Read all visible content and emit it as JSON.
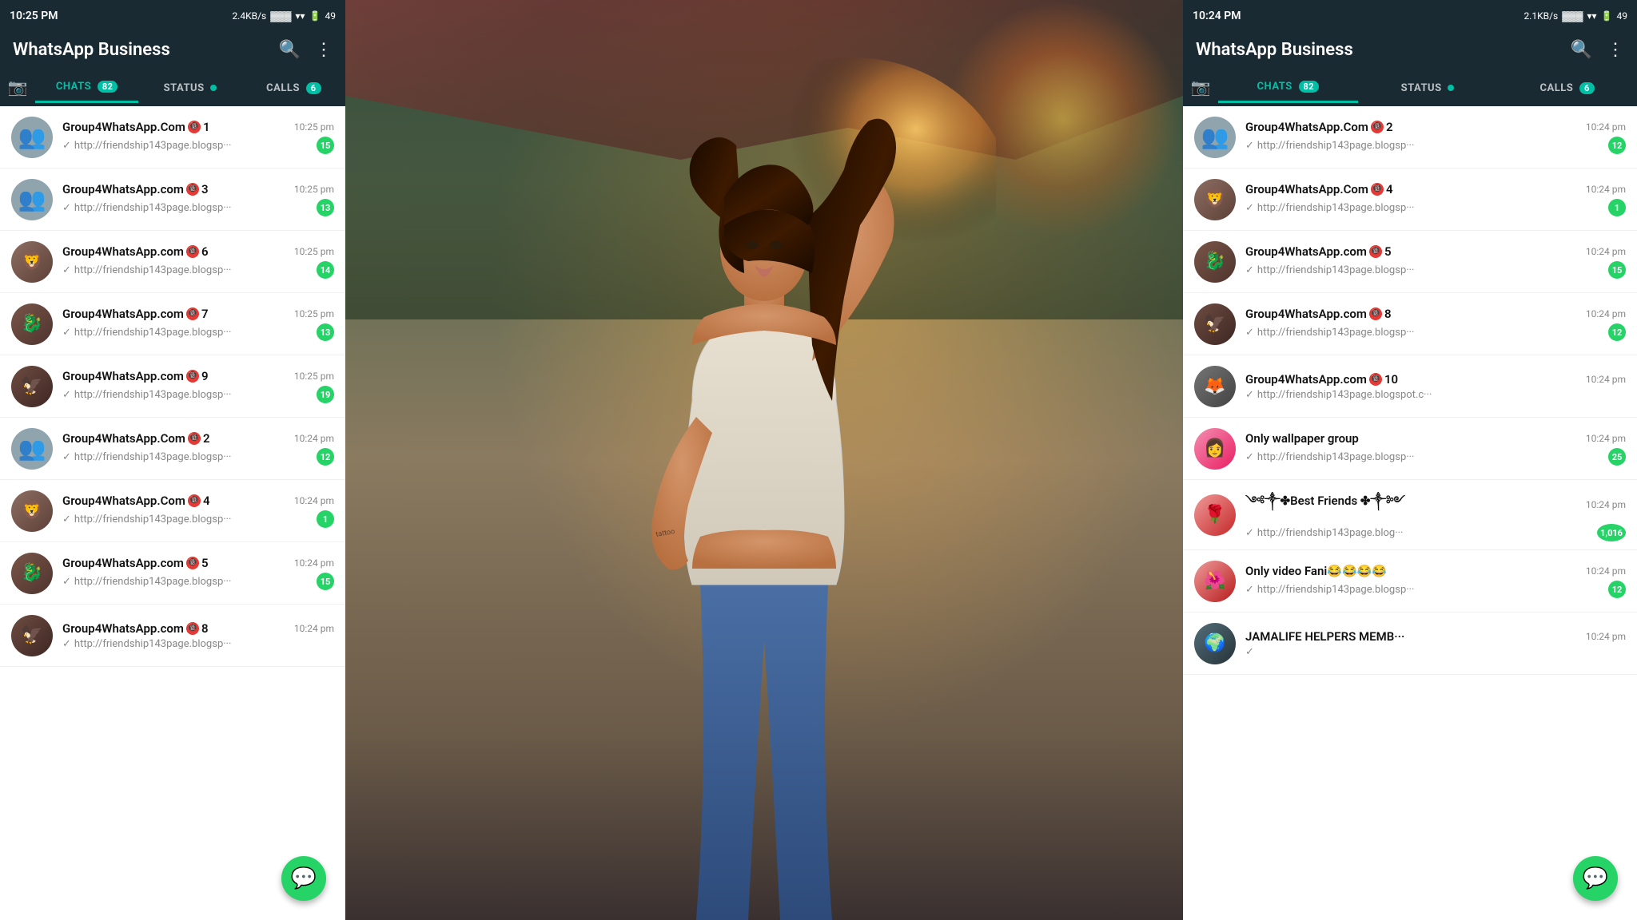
{
  "left": {
    "statusBar": {
      "time": "10:25 PM",
      "speed": "2.4KB/s",
      "battery": "49"
    },
    "appTitle": "WhatsApp Business",
    "tabs": {
      "chats": "CHATS",
      "chatsBadge": "82",
      "status": "STATUS",
      "calls": "CALLS",
      "callsBadge": "6"
    },
    "chats": [
      {
        "name": "Group4WhatsApp.Com",
        "nameNum": "1",
        "time": "10:25 pm",
        "preview": "http://friendship143page.blogsp···",
        "unread": "15",
        "avatarType": "group"
      },
      {
        "name": "Group4WhatsApp.com",
        "nameNum": "3",
        "time": "10:25 pm",
        "preview": "http://friendship143page.blogsp···",
        "unread": "13",
        "avatarType": "group"
      },
      {
        "name": "Group4WhatsApp.com",
        "nameNum": "6",
        "time": "10:25 pm",
        "preview": "http://friendship143page.blogsp···",
        "unread": "14",
        "avatarType": "tattoo1"
      },
      {
        "name": "Group4WhatsApp.com",
        "nameNum": "7",
        "time": "10:25 pm",
        "preview": "http://friendship143page.blogsp···",
        "unread": "13",
        "avatarType": "tattoo2"
      },
      {
        "name": "Group4WhatsApp.com",
        "nameNum": "9",
        "time": "10:25 pm",
        "preview": "http://friendship143page.blogsp···",
        "unread": "19",
        "avatarType": "tattoo3"
      },
      {
        "name": "Group4WhatsApp.Com",
        "nameNum": "2",
        "time": "10:24 pm",
        "preview": "http://friendship143page.blogsp···",
        "unread": "12",
        "avatarType": "group"
      },
      {
        "name": "Group4WhatsApp.Com",
        "nameNum": "4",
        "time": "10:24 pm",
        "preview": "http://friendship143page.blogsp···",
        "unread": "1",
        "avatarType": "tattoo1"
      },
      {
        "name": "Group4WhatsApp.com",
        "nameNum": "5",
        "time": "10:24 pm",
        "preview": "http://friendship143page.blogsp···",
        "unread": "15",
        "avatarType": "tattoo2"
      },
      {
        "name": "Group4WhatsApp.com",
        "nameNum": "8",
        "time": "10:24 pm",
        "preview": "http://friendship143page.blogsp···",
        "unread": "",
        "avatarType": "tattoo3"
      }
    ],
    "fab": "💬"
  },
  "right": {
    "statusBar": {
      "time": "10:24 PM",
      "speed": "2.1KB/s",
      "battery": "49"
    },
    "appTitle": "WhatsApp Business",
    "tabs": {
      "chats": "CHATS",
      "chatsBadge": "82",
      "status": "STATUS",
      "calls": "CALLS",
      "callsBadge": "6"
    },
    "chats": [
      {
        "name": "Group4WhatsApp.Com",
        "nameNum": "2",
        "time": "10:24 pm",
        "preview": "http://friendship143page.blogsp···",
        "unread": "12",
        "avatarType": "group"
      },
      {
        "name": "Group4WhatsApp.Com",
        "nameNum": "4",
        "time": "10:24 pm",
        "preview": "http://friendship143page.blogsp···",
        "unread": "1",
        "avatarType": "tattoo1"
      },
      {
        "name": "Group4WhatsApp.com",
        "nameNum": "5",
        "time": "10:24 pm",
        "preview": "http://friendship143page.blogsp···",
        "unread": "15",
        "avatarType": "tattoo2"
      },
      {
        "name": "Group4WhatsApp.com",
        "nameNum": "8",
        "time": "10:24 pm",
        "preview": "http://friendship143page.blogsp···",
        "unread": "12",
        "avatarType": "tattoo3"
      },
      {
        "name": "Group4WhatsApp.com",
        "nameNum": "10",
        "time": "10:24 pm",
        "preview": "http://friendship143page.blogspot.c···",
        "unread": "",
        "avatarType": "tattoo4"
      },
      {
        "name": "Only wallpaper group",
        "nameNum": "",
        "time": "10:24 pm",
        "preview": "http://friendship143page.blogsp···",
        "unread": "25",
        "avatarType": "pink"
      },
      {
        "name": "༺༒✤Best Friends ✤༒༻",
        "nameNum": "",
        "time": "10:24 pm",
        "preview": "http://friendship143page.blog···",
        "unread": "1,016",
        "avatarType": "flowers"
      },
      {
        "name": "Only video Fani😂😂😂😂",
        "nameNum": "",
        "time": "10:24 pm",
        "preview": "http://friendship143page.blogsp···",
        "unread": "12",
        "avatarType": "flowers2"
      },
      {
        "name": "JAMALIFE HELPERS MEMB···",
        "nameNum": "",
        "time": "10:24 pm",
        "preview": "",
        "unread": "",
        "avatarType": "dark"
      }
    ],
    "fab": "💬"
  }
}
